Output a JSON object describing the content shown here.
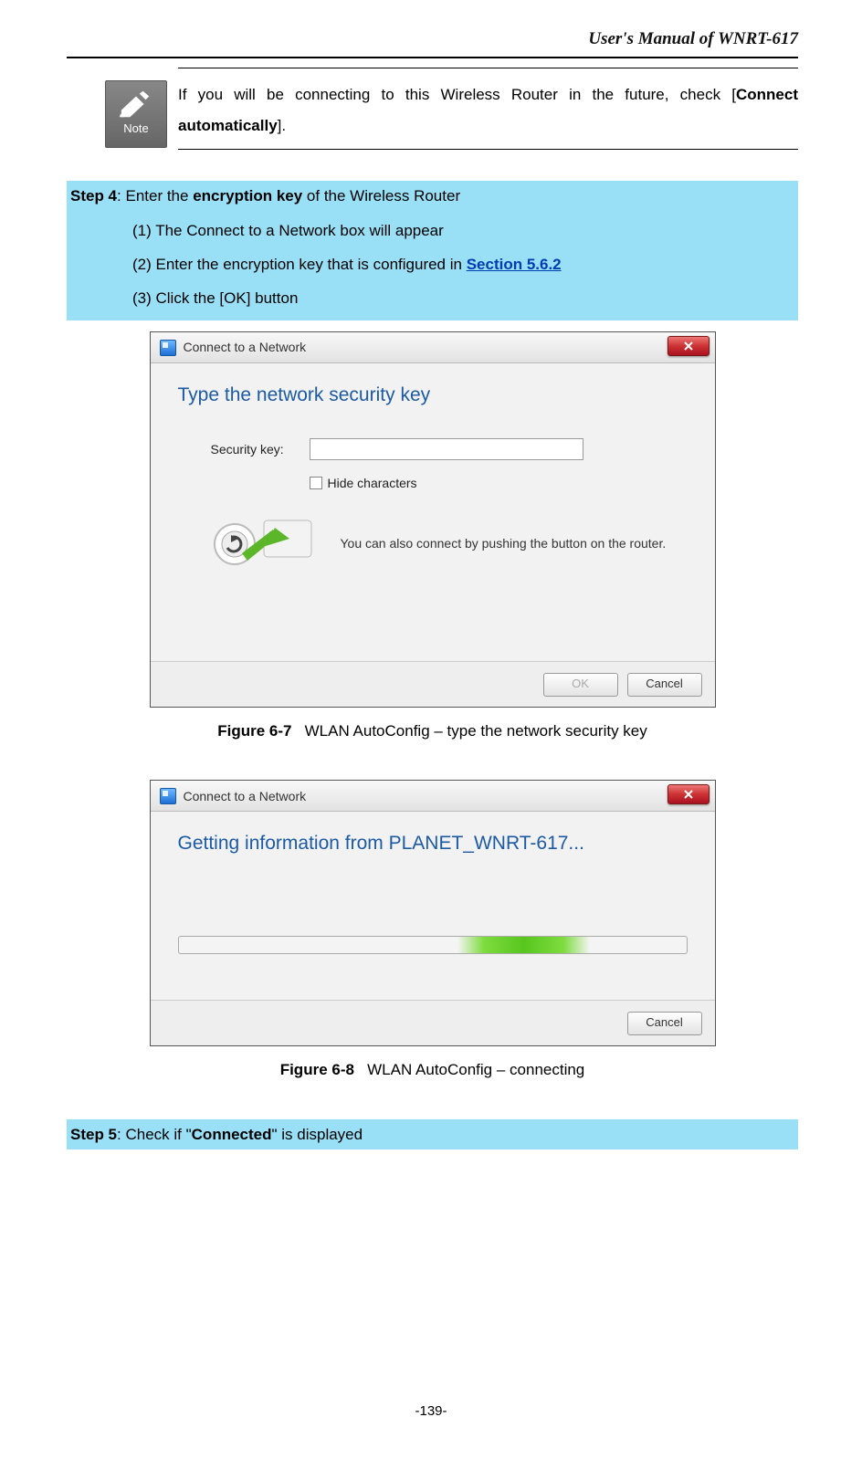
{
  "header": {
    "title": "User's Manual of WNRT-617"
  },
  "note": {
    "icon_label": "Note",
    "text_before": "If you will be connecting to this Wireless Router in the future, check [",
    "bold": "Connect automatically",
    "text_after": "]."
  },
  "step4": {
    "label": "Step 4",
    "rest_before": ": Enter the ",
    "bold": "encryption key",
    "rest_after": " of the Wireless Router",
    "items": {
      "i1": "(1)  The Connect to a Network box will appear",
      "i2_before": "(2)  Enter the encryption key that is configured in ",
      "i2_link": "Section 5.6.2",
      "i3": "(3)  Click the [OK] button"
    }
  },
  "dialog1": {
    "title": "Connect to a Network",
    "heading": "Type the network security key",
    "label": "Security key:",
    "hide": "Hide characters",
    "push": "You can also connect by pushing the button on the router.",
    "ok": "OK",
    "cancel": "Cancel"
  },
  "fig7": {
    "label": "Figure 6-7",
    "caption": "WLAN AutoConfig – type the network security key"
  },
  "dialog2": {
    "title": "Connect to a Network",
    "heading": "Getting information from PLANET_WNRT-617...",
    "cancel": "Cancel"
  },
  "fig8": {
    "label": "Figure 6-8",
    "caption": "WLAN AutoConfig – connecting"
  },
  "step5": {
    "label": "Step 5",
    "rest_before": ": Check if \"",
    "bold": "Connected",
    "rest_after": "\" is displayed"
  },
  "page_number": "-139-"
}
